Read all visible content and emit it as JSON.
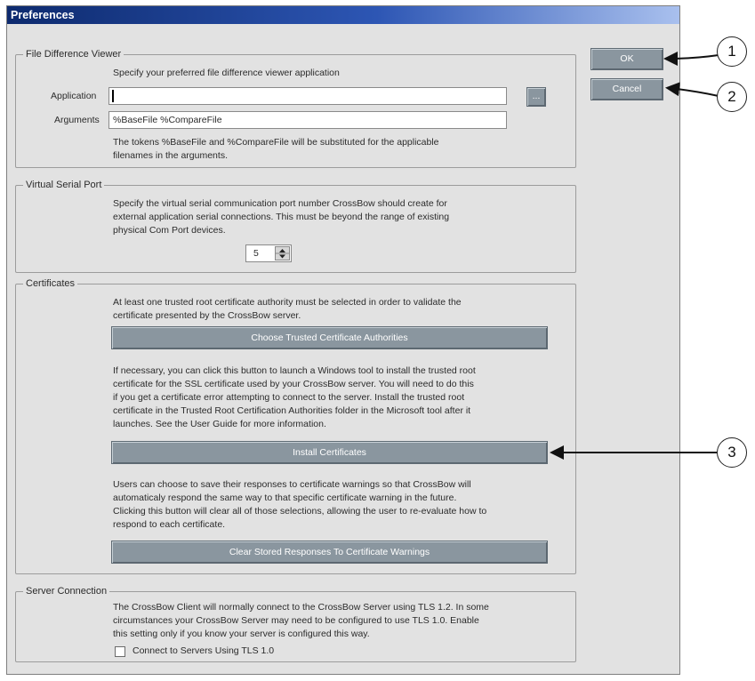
{
  "window": {
    "title": "Preferences"
  },
  "buttons": {
    "ok": "OK",
    "cancel": "Cancel",
    "browse": "..."
  },
  "file_diff": {
    "legend": "File Difference Viewer",
    "intro": "Specify your preferred file difference viewer application",
    "application_label": "Application",
    "application_value": "",
    "arguments_label": "Arguments",
    "arguments_value": "%BaseFile %CompareFile",
    "note_line1": "The tokens %BaseFile and %CompareFile will be substituted for the applicable",
    "note_line2": "filenames in the arguments."
  },
  "serial_port": {
    "legend": "Virtual Serial Port",
    "line1": "Specify the virtual serial communication port number CrossBow should create for",
    "line2": "external application serial connections.  This must be beyond the range of existing",
    "line3": "physical Com Port devices.",
    "port_value": "5"
  },
  "certificates": {
    "legend": "Certificates",
    "p1_line1": "At least one trusted root certificate authority must be selected in order to validate the",
    "p1_line2": "certificate presented by the CrossBow server.",
    "choose_button": "Choose Trusted Certificate Authorities",
    "p2_line1": "If necessary, you can click this button to launch a Windows tool to install the trusted root",
    "p2_line2": "certificate for the SSL certificate used by your CrossBow server.  You will need to do this",
    "p2_line3": "if you get a certificate error attempting to connect to the server.  Install the trusted root",
    "p2_line4": "certificate in the Trusted Root Certification Authorities folder in the Microsoft tool after it",
    "p2_line5": "launches.  See the User Guide for more information.",
    "install_button": "Install Certificates",
    "p3_line1": "Users can choose to save their responses to certificate warnings so that CrossBow will",
    "p3_line2": "automaticaly respond the same way to that specific certificate warning in the future.",
    "p3_line3": "Clicking this button will clear all of those selections, allowing the user to re-evaluate how to",
    "p3_line4": "respond to each certificate.",
    "clear_button": "Clear Stored Responses To Certificate Warnings"
  },
  "server": {
    "legend": "Server Connection",
    "line1": "The CrossBow Client will normally connect to the CrossBow Server using TLS 1.2.  In some",
    "line2": "circumstances your CrossBow Server may need to be configured to use TLS 1.0.  Enable",
    "line3": "this setting only if you know your server is configured this way.",
    "checkbox_label": "Connect to Servers Using TLS 1.0",
    "checkbox_checked": false
  },
  "callouts": {
    "c1": "1",
    "c2": "2",
    "c3": "3"
  }
}
